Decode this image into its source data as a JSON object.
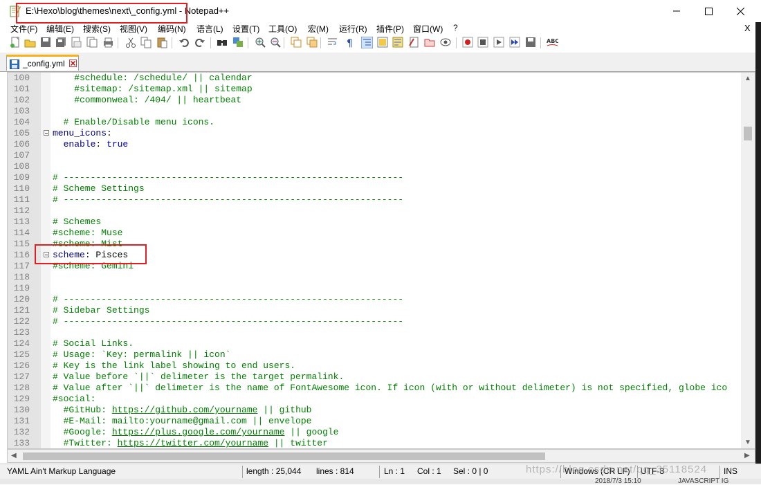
{
  "window": {
    "title": "E:\\Hexo\\blog\\themes\\next\\_config.yml - Notepad++"
  },
  "menu": [
    "文件(F)",
    "编辑(E)",
    "搜索(S)",
    "视图(V)",
    "编码(N)",
    "语言(L)",
    "设置(T)",
    "工具(O)",
    "宏(M)",
    "运行(R)",
    "插件(P)",
    "窗口(W)",
    "?"
  ],
  "menu_close": "X",
  "toolbar": {
    "icons": [
      "new-file-icon",
      "open-file-icon",
      "save-icon",
      "save-all-icon",
      "close-icon",
      "close-all-icon",
      "print-icon",
      "cut-icon",
      "copy-icon",
      "paste-icon",
      "undo-icon",
      "redo-icon",
      "find-icon",
      "replace-icon",
      "zoom-in-icon",
      "zoom-out-icon",
      "sync-vertical-icon",
      "sync-horizontal-icon",
      "word-wrap-icon",
      "show-all-chars-icon",
      "indent-guide-icon",
      "user-language-icon",
      "doc-map-icon",
      "function-list-icon",
      "folder-workspace-icon",
      "monitor-icon",
      "record-macro-icon",
      "stop-macro-icon",
      "play-macro-icon",
      "run-multiple-macro-icon",
      "save-macro-icon",
      "spell-check-icon"
    ]
  },
  "tab": {
    "label": "_config.yml"
  },
  "editor": {
    "lines": [
      {
        "n": "100",
        "fold": false,
        "segs": [
          [
            "c",
            "    #schedule: /schedule/ || calendar"
          ]
        ]
      },
      {
        "n": "101",
        "fold": false,
        "segs": [
          [
            "c",
            "    #sitemap: /sitemap.xml || sitemap"
          ]
        ]
      },
      {
        "n": "102",
        "fold": false,
        "segs": [
          [
            "c",
            "    #commonweal: /404/ || heartbeat"
          ]
        ]
      },
      {
        "n": "103",
        "fold": false,
        "segs": []
      },
      {
        "n": "104",
        "fold": false,
        "segs": [
          [
            "c",
            "  # Enable/Disable menu icons."
          ]
        ]
      },
      {
        "n": "105",
        "fold": true,
        "segs": [
          [
            "k",
            "menu_icons"
          ],
          [
            "t",
            ":"
          ]
        ]
      },
      {
        "n": "106",
        "fold": false,
        "segs": [
          [
            "t",
            "  "
          ],
          [
            "k",
            "enable"
          ],
          [
            "t",
            ": "
          ],
          [
            "b",
            "true"
          ]
        ]
      },
      {
        "n": "107",
        "fold": false,
        "segs": []
      },
      {
        "n": "108",
        "fold": false,
        "segs": []
      },
      {
        "n": "109",
        "fold": false,
        "segs": [
          [
            "c",
            "# ---------------------------------------------------------------"
          ]
        ]
      },
      {
        "n": "110",
        "fold": false,
        "segs": [
          [
            "c",
            "# Scheme Settings"
          ]
        ]
      },
      {
        "n": "111",
        "fold": false,
        "segs": [
          [
            "c",
            "# ---------------------------------------------------------------"
          ]
        ]
      },
      {
        "n": "112",
        "fold": false,
        "segs": []
      },
      {
        "n": "113",
        "fold": false,
        "segs": [
          [
            "c",
            "# Schemes"
          ]
        ]
      },
      {
        "n": "114",
        "fold": false,
        "segs": [
          [
            "c",
            "#scheme: Muse"
          ]
        ]
      },
      {
        "n": "115",
        "fold": false,
        "segs": [
          [
            "c",
            "#scheme: Mist"
          ]
        ]
      },
      {
        "n": "116",
        "fold": true,
        "segs": [
          [
            "k",
            "scheme"
          ],
          [
            "t",
            ": Pisces"
          ]
        ]
      },
      {
        "n": "117",
        "fold": false,
        "segs": [
          [
            "c",
            "#scheme: Gemini"
          ]
        ]
      },
      {
        "n": "118",
        "fold": false,
        "segs": []
      },
      {
        "n": "119",
        "fold": false,
        "segs": []
      },
      {
        "n": "120",
        "fold": false,
        "segs": [
          [
            "c",
            "# ---------------------------------------------------------------"
          ]
        ]
      },
      {
        "n": "121",
        "fold": false,
        "segs": [
          [
            "c",
            "# Sidebar Settings"
          ]
        ]
      },
      {
        "n": "122",
        "fold": false,
        "segs": [
          [
            "c",
            "# ---------------------------------------------------------------"
          ]
        ]
      },
      {
        "n": "123",
        "fold": false,
        "segs": []
      },
      {
        "n": "124",
        "fold": false,
        "segs": [
          [
            "c",
            "# Social Links."
          ]
        ]
      },
      {
        "n": "125",
        "fold": false,
        "segs": [
          [
            "c",
            "# Usage: `Key: permalink || icon`"
          ]
        ]
      },
      {
        "n": "126",
        "fold": false,
        "segs": [
          [
            "c",
            "# Key is the link label showing to end users."
          ]
        ]
      },
      {
        "n": "127",
        "fold": false,
        "segs": [
          [
            "c",
            "# Value before `||` delimeter is the target permalink."
          ]
        ]
      },
      {
        "n": "128",
        "fold": false,
        "segs": [
          [
            "c",
            "# Value after `||` delimeter is the name of FontAwesome icon. If icon (with or without delimeter) is not specified, globe ico"
          ]
        ]
      },
      {
        "n": "129",
        "fold": false,
        "segs": [
          [
            "c",
            "#social:"
          ]
        ]
      },
      {
        "n": "130",
        "fold": false,
        "segs": [
          [
            "c",
            "  #GitHub: "
          ],
          [
            "l",
            "https://github.com/yourname"
          ],
          [
            "c",
            " || github"
          ]
        ]
      },
      {
        "n": "131",
        "fold": false,
        "segs": [
          [
            "c",
            "  #E-Mail: mailto:yourname@gmail.com || envelope"
          ]
        ]
      },
      {
        "n": "132",
        "fold": false,
        "segs": [
          [
            "c",
            "  #Google: "
          ],
          [
            "l",
            "https://plus.google.com/yourname"
          ],
          [
            "c",
            " || google"
          ]
        ]
      },
      {
        "n": "133",
        "fold": false,
        "segs": [
          [
            "c",
            "  #Twitter: "
          ],
          [
            "l",
            "https://twitter.com/yourname"
          ],
          [
            "c",
            " || twitter"
          ]
        ]
      }
    ]
  },
  "status": {
    "language": "YAML Ain't Markup Language",
    "length": "length : 25,044",
    "lines": "lines : 814",
    "ln": "Ln : 1",
    "col": "Col : 1",
    "sel": "Sel : 0 | 0",
    "eol": "Windows (CR LF)",
    "encoding": "UTF-8",
    "ins": "INS"
  },
  "watermark": "https://blog.csdn.net/qq_35118524",
  "background_text": [
    "2018/7/3 15:10",
    "JAVASCRIPT IG"
  ],
  "colors": {
    "comment": "#008000",
    "key": "#000080",
    "boolean": "#0000c0",
    "highlight": "#e02020",
    "tab_accent": "#f5b21b"
  }
}
